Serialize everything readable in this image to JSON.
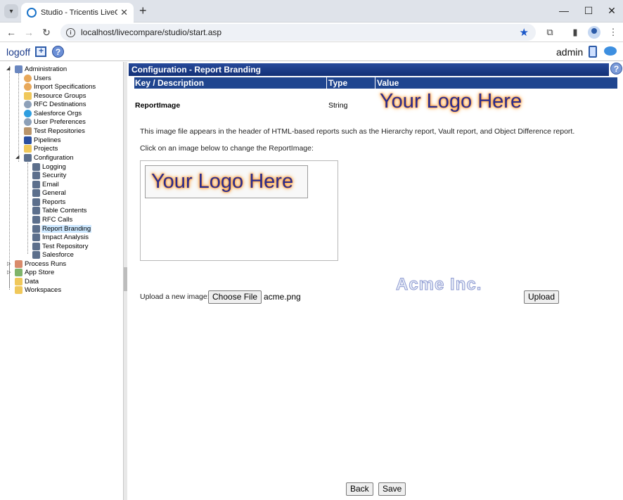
{
  "browser": {
    "tab_title": "Studio - Tricentis LiveCompare",
    "tab_close": "✕",
    "new_tab": "+",
    "url": "localhost/livecompare/studio/start.asp",
    "window_controls": {
      "minimize": "—",
      "maximize": "☐",
      "close": "✕"
    }
  },
  "app_header": {
    "logoff": "logoff",
    "help": "?",
    "user": "admin"
  },
  "tree": {
    "items": [
      {
        "label": "Administration",
        "icon": "admin-icon"
      },
      {
        "label": "Users",
        "icon": "user-icon"
      },
      {
        "label": "Import Specifications",
        "icon": "user-icon"
      },
      {
        "label": "Resource Groups",
        "icon": "folder-icon"
      },
      {
        "label": "RFC Destinations",
        "icon": "gear-icon"
      },
      {
        "label": "Salesforce Orgs",
        "icon": "cloud-icon"
      },
      {
        "label": "User Preferences",
        "icon": "gear-icon"
      },
      {
        "label": "Test Repositories",
        "icon": "repo-icon"
      },
      {
        "label": "Pipelines",
        "icon": "pipeline-icon"
      },
      {
        "label": "Projects",
        "icon": "folder-icon"
      },
      {
        "label": "Configuration",
        "icon": "sliders-icon"
      },
      {
        "label": "Logging",
        "icon": "sliders-icon"
      },
      {
        "label": "Security",
        "icon": "sliders-icon"
      },
      {
        "label": "Email",
        "icon": "sliders-icon"
      },
      {
        "label": "General",
        "icon": "sliders-icon"
      },
      {
        "label": "Reports",
        "icon": "sliders-icon"
      },
      {
        "label": "Table Contents",
        "icon": "sliders-icon"
      },
      {
        "label": "RFC Calls",
        "icon": "sliders-icon"
      },
      {
        "label": "Report Branding",
        "icon": "sliders-icon"
      },
      {
        "label": "Impact Analysis",
        "icon": "sliders-icon"
      },
      {
        "label": "Test Repository",
        "icon": "sliders-icon"
      },
      {
        "label": "Salesforce",
        "icon": "sliders-icon"
      },
      {
        "label": "Process Runs",
        "icon": "process-icon"
      },
      {
        "label": "App Store",
        "icon": "store-icon"
      },
      {
        "label": "Data",
        "icon": "folder-icon"
      },
      {
        "label": "Workspaces",
        "icon": "folder-icon"
      }
    ],
    "selected": "Report Branding"
  },
  "main": {
    "title": "Configuration - Report Branding",
    "help": "?",
    "columns": {
      "key": "Key / Description",
      "type": "Type",
      "value": "Value"
    },
    "row": {
      "key": "ReportImage",
      "type": "String",
      "value_logo": "Your Logo Here"
    },
    "description": "This image file appears in the header of HTML-based reports such as the Hierarchy report, Vault report, and Object Difference report.",
    "click_instruction": "Click on an image below to change the ReportImage:",
    "image_option_logo": "Your Logo Here",
    "acme_logo": "Acme Inc.",
    "upload_label": "Upload a new image:",
    "choose_file": "Choose File",
    "chosen_file": "acme.png",
    "upload_button": "Upload",
    "back_button": "Back",
    "save_button": "Save"
  }
}
